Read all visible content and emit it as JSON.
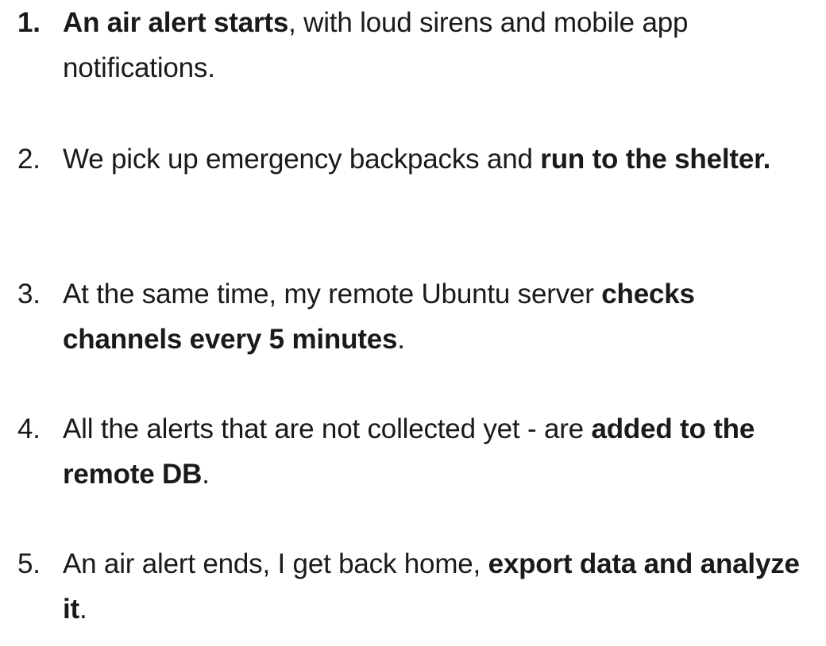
{
  "steps": [
    {
      "number": "1.",
      "pre": "",
      "bold": "An air alert starts",
      "post": ", with loud sirens and mobile app notifications."
    },
    {
      "number": "2.",
      "pre": "We pick up emergency backpacks and ",
      "bold": "run to the shelter.",
      "post": ""
    },
    {
      "number": "3.",
      "pre": "At the same time, my remote Ubuntu server ",
      "bold": "checks channels every 5 minutes",
      "post": "."
    },
    {
      "number": "4.",
      "pre": "All the alerts that are not collected yet - are ",
      "bold": "added to the remote DB",
      "post": "."
    },
    {
      "number": "5.",
      "pre": "An air alert ends, I get back home, ",
      "bold": "export data and analyze it",
      "post": "."
    }
  ]
}
